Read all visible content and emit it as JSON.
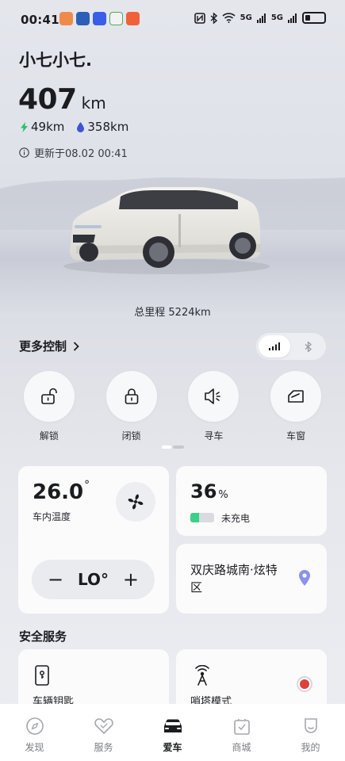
{
  "status_bar": {
    "time": "00:41",
    "signal_label_1": "5G",
    "signal_label_2": "5G"
  },
  "car": {
    "name": "小七小七.",
    "range_value": "407",
    "range_unit": "km",
    "electric_range": "49km",
    "fuel_range": "358km",
    "updated_text": "更新于08.02 00:41",
    "odometer": "总里程 5224km"
  },
  "controls": {
    "more_label": "更多控制",
    "items": [
      {
        "label": "解锁",
        "icon": "unlock-icon"
      },
      {
        "label": "闭锁",
        "icon": "lock-icon"
      },
      {
        "label": "寻车",
        "icon": "horn-icon"
      },
      {
        "label": "车窗",
        "icon": "window-icon"
      }
    ]
  },
  "climate": {
    "temperature": "26.0",
    "degree": "°",
    "label": "车内温度",
    "ac_mode": "LO°",
    "minus": "−",
    "plus": "+"
  },
  "battery": {
    "percent": "36",
    "percent_unit": "%",
    "level": 0.36,
    "status": "未充电",
    "fill_color": "#3ccf8a"
  },
  "location": {
    "address": "双庆路城南·炫特区",
    "pin_color": "#8a93e8"
  },
  "safety": {
    "title": "安全服务",
    "items": [
      {
        "label": "车辆钥匙",
        "icon": "phone-key-icon"
      },
      {
        "label": "哨塔模式",
        "icon": "sentry-tower-icon"
      }
    ]
  },
  "tabs": [
    {
      "label": "发现",
      "icon": "compass-icon",
      "active": false
    },
    {
      "label": "服务",
      "icon": "service-heart-icon",
      "active": false
    },
    {
      "label": "爱车",
      "icon": "car-icon",
      "active": true
    },
    {
      "label": "商城",
      "icon": "shop-bag-icon",
      "active": false
    },
    {
      "label": "我的",
      "icon": "profile-icon",
      "active": false
    }
  ]
}
